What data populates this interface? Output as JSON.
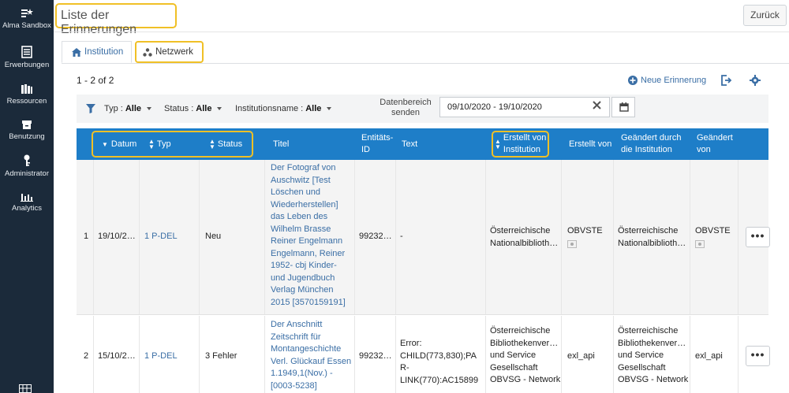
{
  "nav": {
    "items": [
      {
        "label": "Alma Sandbox",
        "icon": "alma-sandbox-icon"
      },
      {
        "label": "Erwerbungen",
        "icon": "acquisitions-icon"
      },
      {
        "label": "Ressourcen",
        "icon": "resources-icon"
      },
      {
        "label": "Benutzung",
        "icon": "fulfillment-icon"
      },
      {
        "label": "Administrator",
        "icon": "admin-icon"
      },
      {
        "label": "Analytics",
        "icon": "analytics-icon"
      }
    ]
  },
  "header": {
    "title": "Liste der Erinnerungen",
    "back_label": "Zurück"
  },
  "tabs": [
    {
      "label": "Institution",
      "icon": "home-icon"
    },
    {
      "label": "Netzwerk",
      "icon": "network-icon"
    }
  ],
  "toolbar": {
    "count": "1 - 2 of 2",
    "new_reminder": "Neue Erinnerung"
  },
  "filters": {
    "typ_label": "Typ :",
    "typ_value": "Alle",
    "status_label": "Status :",
    "status_value": "Alle",
    "inst_label": "Institutionsname :",
    "inst_value": "Alle",
    "date_label": "Datenbereich senden",
    "date_value": "09/10/2020 - 19/10/2020"
  },
  "table": {
    "headers": {
      "datum": "Datum",
      "typ": "Typ",
      "status": "Status",
      "titel": "Titel",
      "entity": "Entitäts-ID",
      "text": "Text",
      "created_inst": "Erstellt von Institution",
      "created_by": "Erstellt von",
      "changed_inst": "Geändert durch die Institution",
      "changed_by": "Geändert von"
    },
    "rows": [
      {
        "num": "1",
        "date": "19/10/2…",
        "type": "1 P-DEL",
        "status": "Neu",
        "title": "Der Fotograf von Auschwitz [Test Löschen und Wiederherstellen] das Leben des Wilhelm Brasse Reiner Engelmann Engelmann, Reiner 1952- cbj Kinder- und Jugendbuch Verlag München 2015 [3570159191]",
        "entity": "99232…",
        "text": "-",
        "created_inst": "Österreichische Nationalbiblioth…",
        "created_by": "OBVSTE",
        "changed_inst": "Österreichische Nationalbiblioth…",
        "changed_by": "OBVSTE",
        "actions": "•••"
      },
      {
        "num": "2",
        "date": "15/10/2…",
        "type": "1 P-DEL",
        "status": "3 Fehler",
        "title": "Der Anschnitt Zeitschrift für Montangeschichte Verl. Glückauf Essen 1.1949,1(Nov.) - [0003-5238]",
        "entity": "99232…",
        "text": "Error: CHILD(773,830);PAR-LINK(770):AC15899…",
        "created_inst": "Österreichische Bibliothekenver… und Service Gesellschaft OBVSG - Network",
        "created_by": "exl_api",
        "changed_inst": "Österreichische Bibliothekenver… und Service Gesellschaft OBVSG - Network",
        "changed_by": "exl_api",
        "actions": "•••"
      }
    ]
  },
  "colors": {
    "nav_bg": "#1b2a3a",
    "table_header": "#1e7ec8",
    "highlight": "#f0c026",
    "link": "#3a6ea5"
  }
}
